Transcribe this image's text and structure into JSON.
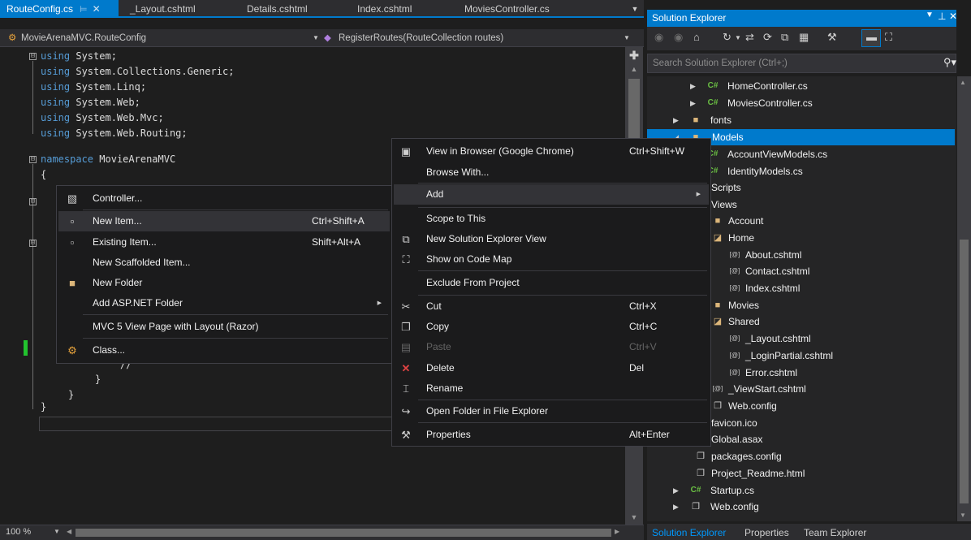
{
  "editor": {
    "tabs": [
      {
        "label": "RouteConfig.cs",
        "pin": "⊨",
        "close": "✕",
        "active": true
      },
      {
        "label": "_Layout.cshtml"
      },
      {
        "label": "Details.cshtml"
      },
      {
        "label": "Index.cshtml"
      },
      {
        "label": "MoviesController.cs"
      }
    ],
    "overflow_icon": "chevron-down-icon",
    "nav": {
      "class_combo": "MovieArenaMVC.RouteConfig",
      "member_combo": "RegisterRoutes(RouteCollection routes)"
    },
    "code": {
      "using_keyword": "using",
      "usings": [
        "System;",
        "System.Collections.Generic;",
        "System.Linq;",
        "System.Web;",
        "System.Web.Mvc;",
        "System.Web.Routing;"
      ],
      "namespace_keyword": "namespace",
      "namespace_name": "MovieArenaMVC",
      "open_brace": "{",
      "close_brace": "}",
      "inner_tail": "//",
      "collapse_glyph": "⊟"
    },
    "zoom": "100 %"
  },
  "add_menu": {
    "items": [
      {
        "label": "Controller...",
        "icon": "controller-icon"
      },
      {
        "label": "New Item...",
        "shortcut": "Ctrl+Shift+A",
        "icon": "new-item-icon",
        "highlight": true
      },
      {
        "label": "Existing Item...",
        "shortcut": "Shift+Alt+A",
        "icon": "existing-item-icon"
      },
      {
        "label": "New Scaffolded Item..."
      },
      {
        "label": "New Folder",
        "icon": "folder-icon"
      },
      {
        "label": "Add ASP.NET Folder",
        "submenu": true
      },
      {
        "label": "MVC 5 View Page with Layout (Razor)"
      },
      {
        "label": "Class...",
        "icon": "class-icon"
      }
    ]
  },
  "folder_menu": {
    "items": [
      {
        "label": "View in Browser (Google Chrome)",
        "shortcut": "Ctrl+Shift+W",
        "icon": "browser-icon"
      },
      {
        "label": "Browse With..."
      },
      {
        "label": "Add",
        "submenu": true,
        "highlight": true
      },
      {
        "label": "Scope to This"
      },
      {
        "label": "New Solution Explorer View",
        "icon": "new-view-icon"
      },
      {
        "label": "Show on Code Map",
        "icon": "code-map-icon"
      },
      {
        "label": "Exclude From Project"
      },
      {
        "label": "Cut",
        "shortcut": "Ctrl+X",
        "icon": "scissors-icon"
      },
      {
        "label": "Copy",
        "shortcut": "Ctrl+C",
        "icon": "copy-icon"
      },
      {
        "label": "Paste",
        "shortcut": "Ctrl+V",
        "icon": "paste-icon",
        "disabled": true
      },
      {
        "label": "Delete",
        "shortcut": "Del",
        "icon": "delete-icon"
      },
      {
        "label": "Rename",
        "icon": "rename-icon"
      },
      {
        "label": "Open Folder in File Explorer",
        "icon": "open-folder-icon"
      },
      {
        "label": "Properties",
        "shortcut": "Alt+Enter",
        "icon": "wrench-icon"
      }
    ]
  },
  "solution_explorer": {
    "title": "Solution Explorer",
    "search_placeholder": "Search Solution Explorer (Ctrl+;)",
    "tree": [
      {
        "label": "HomeController.cs",
        "icon": "csharp-icon"
      },
      {
        "label": "MoviesController.cs",
        "icon": "csharp-icon"
      },
      {
        "label": "fonts",
        "icon": "folder-icon"
      },
      {
        "label": "Models",
        "icon": "folder-icon",
        "selected": true
      },
      {
        "label": "AccountViewModels.cs",
        "icon": "csharp-icon"
      },
      {
        "label": "IdentityModels.cs",
        "icon": "csharp-icon"
      },
      {
        "label": "Scripts",
        "icon": "folder-icon"
      },
      {
        "label": "Views",
        "icon": "folder-icon"
      },
      {
        "label": "Account",
        "icon": "folder-icon"
      },
      {
        "label": "Home",
        "icon": "folder-icon"
      },
      {
        "label": "About.cshtml",
        "icon": "razor-icon"
      },
      {
        "label": "Contact.cshtml",
        "icon": "razor-icon"
      },
      {
        "label": "Index.cshtml",
        "icon": "razor-icon"
      },
      {
        "label": "Movies",
        "icon": "folder-icon"
      },
      {
        "label": "Shared",
        "icon": "folder-icon"
      },
      {
        "label": "_Layout.cshtml",
        "icon": "razor-icon"
      },
      {
        "label": "_LoginPartial.cshtml",
        "icon": "razor-icon"
      },
      {
        "label": "Error.cshtml",
        "icon": "razor-icon"
      },
      {
        "label": "_ViewStart.cshtml",
        "icon": "razor-icon"
      },
      {
        "label": "Web.config",
        "icon": "config-icon"
      },
      {
        "label": "favicon.ico",
        "icon": "file-icon"
      },
      {
        "label": "Global.asax",
        "icon": "file-icon"
      },
      {
        "label": "packages.config",
        "icon": "config-icon"
      },
      {
        "label": "Project_Readme.html",
        "icon": "file-icon"
      },
      {
        "label": "Startup.cs",
        "icon": "csharp-icon"
      },
      {
        "label": "Web.config",
        "icon": "config-icon"
      }
    ],
    "bottom_tabs": [
      "Solution Explorer",
      "Properties",
      "Team Explorer"
    ]
  }
}
